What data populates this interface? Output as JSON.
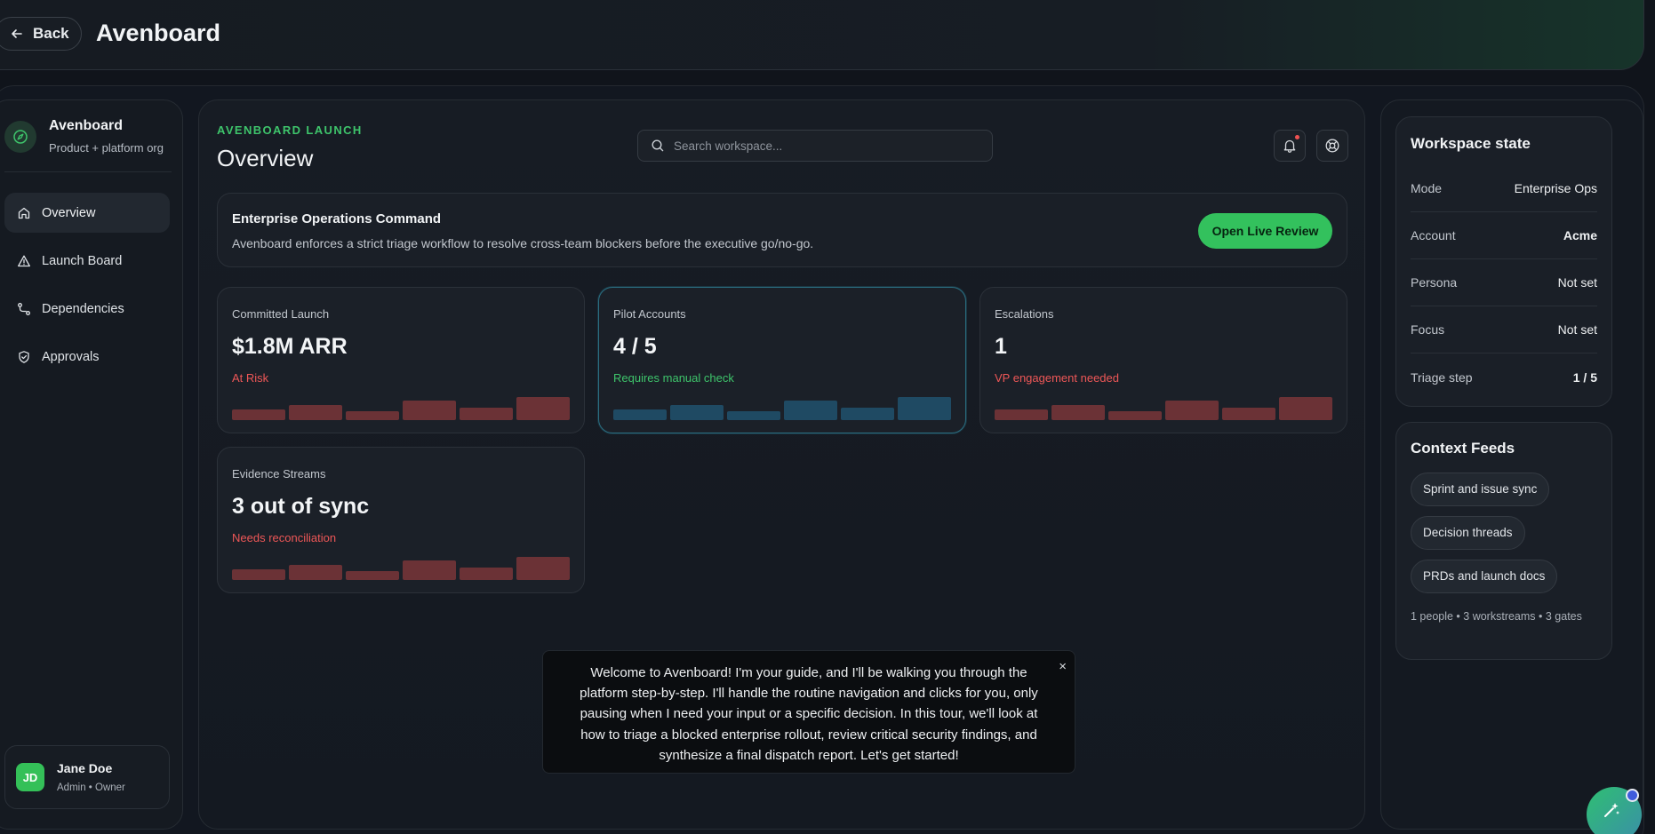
{
  "header": {
    "back_label": "Back",
    "app_title": "Avenboard"
  },
  "sidebar": {
    "org_name": "Avenboard",
    "org_sub": "Product + platform org",
    "items": [
      {
        "label": "Overview",
        "icon": "home-icon"
      },
      {
        "label": "Launch Board",
        "icon": "warning-triangle-icon"
      },
      {
        "label": "Dependencies",
        "icon": "route-icon"
      },
      {
        "label": "Approvals",
        "icon": "shield-check-icon"
      }
    ],
    "user": {
      "initials": "JD",
      "name": "Jane Doe",
      "role": "Admin • Owner"
    }
  },
  "main": {
    "eyebrow": "AVENBOARD LAUNCH",
    "title": "Overview",
    "search_placeholder": "Search workspace...",
    "banner": {
      "title": "Enterprise Operations Command",
      "description": "Avenboard enforces a strict triage workflow to resolve cross-team blockers before the executive go/no-go.",
      "cta": "Open Live Review"
    },
    "cards": [
      {
        "label": "Committed Launch",
        "value": "$1.8M ARR",
        "status": "At Risk",
        "tone": "red"
      },
      {
        "label": "Pilot Accounts",
        "value": "4 / 5",
        "status": "Requires manual check",
        "tone": "green"
      },
      {
        "label": "Escalations",
        "value": "1",
        "status": "VP engagement needed",
        "tone": "red"
      },
      {
        "label": "Evidence Streams",
        "value": "3 out of sync",
        "status": "Needs reconciliation",
        "tone": "red"
      }
    ],
    "sparkline_levels": [
      0.3,
      0.55,
      0.22,
      0.8,
      0.42,
      1.0
    ]
  },
  "tooltip": {
    "text": "Welcome to Avenboard! I'm your guide, and I'll be walking you through the platform step-by-step. I'll handle the routine navigation and clicks for you, only pausing when I need your input or a specific decision. In this tour, we'll look at how to triage a blocked enterprise rollout, review critical security findings, and synthesize a final dispatch report. Let's get started!",
    "close": "×"
  },
  "workspace": {
    "title": "Workspace state",
    "rows": [
      {
        "key": "Mode",
        "value": "Enterprise Ops"
      },
      {
        "key": "Account",
        "value": "Acme"
      },
      {
        "key": "Persona",
        "value": "Not set"
      },
      {
        "key": "Focus",
        "value": "Not set"
      },
      {
        "key": "Triage step",
        "value": "1 / 5"
      }
    ]
  },
  "feeds": {
    "title": "Context Feeds",
    "chips": [
      "Sprint and issue sync",
      "Decision threads",
      "PRDs and launch docs"
    ],
    "meta": "1 people • 3 workstreams • 3 gates"
  },
  "colors": {
    "accent": "#33c15d",
    "danger": "#ee5757",
    "highlight": "#2a6d80"
  }
}
